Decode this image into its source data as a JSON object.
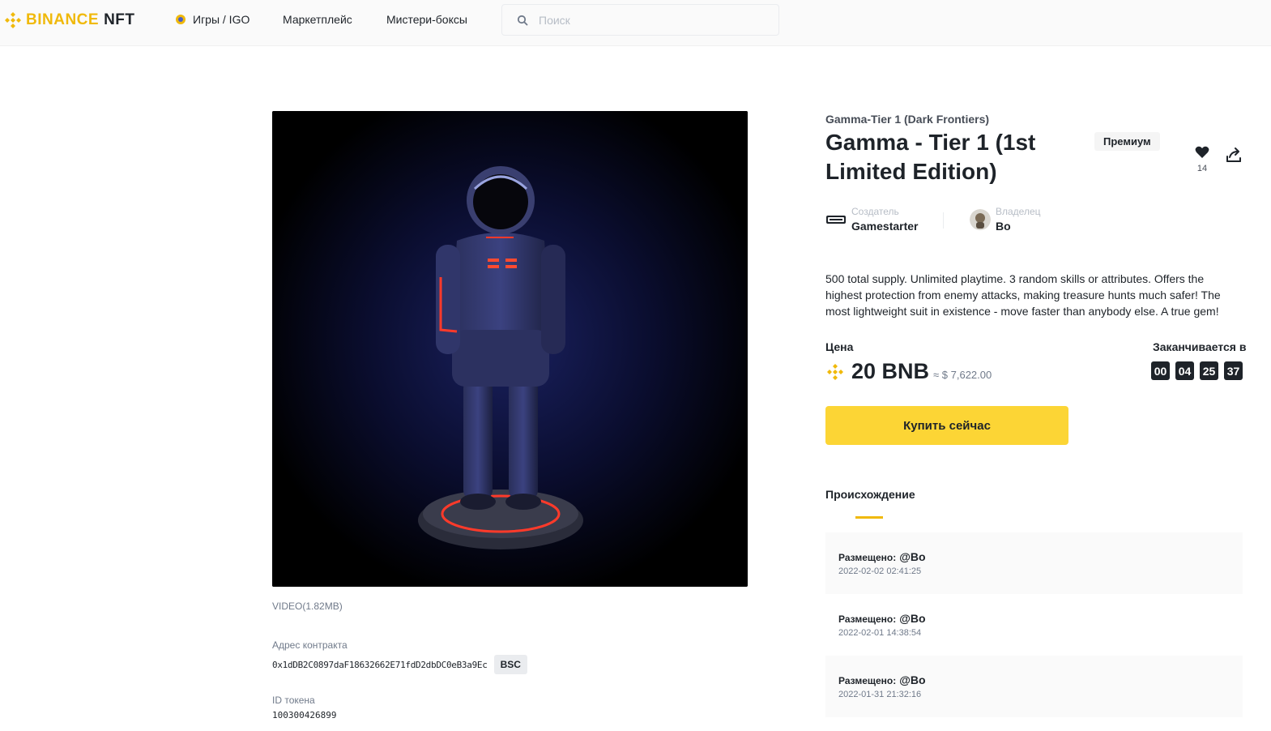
{
  "header": {
    "logo_text": "BINANCE",
    "logo_suffix": "NFT",
    "nav": {
      "games": "Игры / IGO",
      "marketplace": "Маркетплейс",
      "mystery_boxes": "Мистери-боксы"
    },
    "search_placeholder": "Поиск"
  },
  "media": {
    "info": "VIDEO(1.82MB)",
    "contract_label": "Адрес контракта",
    "contract_address": "0x1dDB2C0897daF18632662E71fdD2dbDC0eB3a9Ec",
    "chain": "BSC",
    "token_label": "ID токена",
    "token_id": "100300426899"
  },
  "item": {
    "collection": "Gamma-Tier 1 (Dark Frontiers)",
    "title": "Gamma - Tier 1 (1st Limited Edition)",
    "badge": "Премиум",
    "likes": "14",
    "creator_label": "Создатель",
    "creator_name": "Gamestarter",
    "owner_label": "Владелец",
    "owner_name": "Bo",
    "description": "500 total supply. Unlimited playtime. 3 random skills or attributes. Offers the highest protection from enemy attacks, making treasure hunts much safer! The most lightweight suit in existence - move faster than anybody else. A true gem!"
  },
  "price": {
    "label": "Цена",
    "value": "20 BNB",
    "usd": "≈ $ 7,622.00",
    "ends_label": "Заканчивается в",
    "timer": [
      "00",
      "04",
      "25",
      "37"
    ],
    "buy_label": "Купить сейчас"
  },
  "history": {
    "title": "Происхождение",
    "items": [
      {
        "action": "Размещено:",
        "user": "@Bo",
        "date": "2022-02-02 02:41:25"
      },
      {
        "action": "Размещено:",
        "user": "@Bo",
        "date": "2022-02-01 14:38:54"
      },
      {
        "action": "Размещено:",
        "user": "@Bo",
        "date": "2022-01-31 21:32:16"
      }
    ]
  },
  "colors": {
    "brand": "#f0b90b",
    "button": "#fcd535",
    "text": "#1e2329",
    "muted": "#707a8a"
  }
}
